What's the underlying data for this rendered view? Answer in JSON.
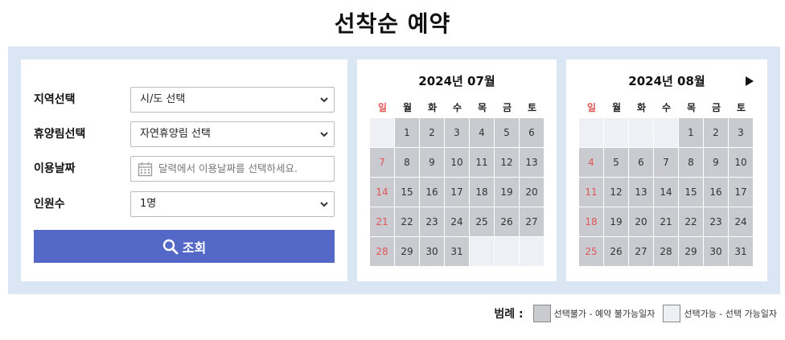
{
  "page_title": "선착순 예약",
  "form": {
    "region": {
      "label": "지역선택",
      "value": "시/도 선택"
    },
    "forest": {
      "label": "휴양림선택",
      "value": "자연휴양림 선택"
    },
    "date": {
      "label": "이용날짜",
      "placeholder": "달력에서 이용날짜를 선택하세요."
    },
    "people": {
      "label": "인원수",
      "value": "1명"
    },
    "search_label": "조회"
  },
  "weekdays": [
    "일",
    "월",
    "화",
    "수",
    "목",
    "금",
    "토"
  ],
  "calendars": [
    {
      "title": "2024년 07월",
      "has_next_arrow": false,
      "weeks": [
        [
          null,
          "1",
          "2",
          "3",
          "4",
          "5",
          "6"
        ],
        [
          "7",
          "8",
          "9",
          "10",
          "11",
          "12",
          "13"
        ],
        [
          "14",
          "15",
          "16",
          "17",
          "18",
          "19",
          "20"
        ],
        [
          "21",
          "22",
          "23",
          "24",
          "25",
          "26",
          "27"
        ],
        [
          "28",
          "29",
          "30",
          "31",
          null,
          null,
          null
        ]
      ]
    },
    {
      "title": "2024년 08월",
      "has_next_arrow": true,
      "weeks": [
        [
          null,
          null,
          null,
          null,
          "1",
          "2",
          "3"
        ],
        [
          "4",
          "5",
          "6",
          "7",
          "8",
          "9",
          "10"
        ],
        [
          "11",
          "12",
          "13",
          "14",
          "15",
          "16",
          "17"
        ],
        [
          "18",
          "19",
          "20",
          "21",
          "22",
          "23",
          "24"
        ],
        [
          "25",
          "26",
          "27",
          "28",
          "29",
          "30",
          "31"
        ]
      ]
    }
  ],
  "legend": {
    "title": "범례 :",
    "unavailable": "선택불가 - 예약 불가능일자",
    "available": "선택가능 - 선택 가능일자"
  },
  "colors": {
    "panel_bg": "#dbe6f4",
    "button": "#5468c8",
    "unavailable_day": "#c9cbd0",
    "available_day": "#eef0f5",
    "sunday": "#e05555"
  },
  "icons": {
    "search": "search-icon",
    "calendar": "calendar-icon",
    "dropdown": "chevron-down-icon",
    "next": "next-month-arrow-icon"
  }
}
